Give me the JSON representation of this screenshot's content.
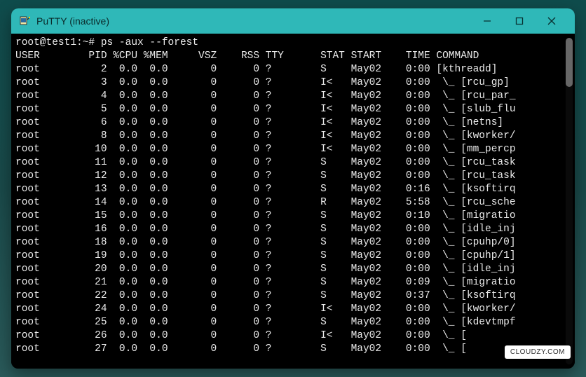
{
  "window": {
    "title": "PuTTY (inactive)"
  },
  "prompt": {
    "user_host": "root@test1",
    "path": "~",
    "symbol": "#",
    "command": "ps -aux --forest"
  },
  "headers": [
    "USER",
    "PID",
    "%CPU",
    "%MEM",
    "VSZ",
    "RSS",
    "TTY",
    "STAT",
    "START",
    "TIME",
    "COMMAND"
  ],
  "rows": [
    {
      "user": "root",
      "pid": "2",
      "cpu": "0.0",
      "mem": "0.0",
      "vsz": "0",
      "rss": "0",
      "tty": "?",
      "stat": "S",
      "start": "May02",
      "time": "0:00",
      "cmd": "[kthreadd]"
    },
    {
      "user": "root",
      "pid": "3",
      "cpu": "0.0",
      "mem": "0.0",
      "vsz": "0",
      "rss": "0",
      "tty": "?",
      "stat": "I<",
      "start": "May02",
      "time": "0:00",
      "cmd": " \\_ [rcu_gp]"
    },
    {
      "user": "root",
      "pid": "4",
      "cpu": "0.0",
      "mem": "0.0",
      "vsz": "0",
      "rss": "0",
      "tty": "?",
      "stat": "I<",
      "start": "May02",
      "time": "0:00",
      "cmd": " \\_ [rcu_par_"
    },
    {
      "user": "root",
      "pid": "5",
      "cpu": "0.0",
      "mem": "0.0",
      "vsz": "0",
      "rss": "0",
      "tty": "?",
      "stat": "I<",
      "start": "May02",
      "time": "0:00",
      "cmd": " \\_ [slub_flu"
    },
    {
      "user": "root",
      "pid": "6",
      "cpu": "0.0",
      "mem": "0.0",
      "vsz": "0",
      "rss": "0",
      "tty": "?",
      "stat": "I<",
      "start": "May02",
      "time": "0:00",
      "cmd": " \\_ [netns]"
    },
    {
      "user": "root",
      "pid": "8",
      "cpu": "0.0",
      "mem": "0.0",
      "vsz": "0",
      "rss": "0",
      "tty": "?",
      "stat": "I<",
      "start": "May02",
      "time": "0:00",
      "cmd": " \\_ [kworker/"
    },
    {
      "user": "root",
      "pid": "10",
      "cpu": "0.0",
      "mem": "0.0",
      "vsz": "0",
      "rss": "0",
      "tty": "?",
      "stat": "I<",
      "start": "May02",
      "time": "0:00",
      "cmd": " \\_ [mm_percp"
    },
    {
      "user": "root",
      "pid": "11",
      "cpu": "0.0",
      "mem": "0.0",
      "vsz": "0",
      "rss": "0",
      "tty": "?",
      "stat": "S",
      "start": "May02",
      "time": "0:00",
      "cmd": " \\_ [rcu_task"
    },
    {
      "user": "root",
      "pid": "12",
      "cpu": "0.0",
      "mem": "0.0",
      "vsz": "0",
      "rss": "0",
      "tty": "?",
      "stat": "S",
      "start": "May02",
      "time": "0:00",
      "cmd": " \\_ [rcu_task"
    },
    {
      "user": "root",
      "pid": "13",
      "cpu": "0.0",
      "mem": "0.0",
      "vsz": "0",
      "rss": "0",
      "tty": "?",
      "stat": "S",
      "start": "May02",
      "time": "0:16",
      "cmd": " \\_ [ksoftirq"
    },
    {
      "user": "root",
      "pid": "14",
      "cpu": "0.0",
      "mem": "0.0",
      "vsz": "0",
      "rss": "0",
      "tty": "?",
      "stat": "R",
      "start": "May02",
      "time": "5:58",
      "cmd": " \\_ [rcu_sche"
    },
    {
      "user": "root",
      "pid": "15",
      "cpu": "0.0",
      "mem": "0.0",
      "vsz": "0",
      "rss": "0",
      "tty": "?",
      "stat": "S",
      "start": "May02",
      "time": "0:10",
      "cmd": " \\_ [migratio"
    },
    {
      "user": "root",
      "pid": "16",
      "cpu": "0.0",
      "mem": "0.0",
      "vsz": "0",
      "rss": "0",
      "tty": "?",
      "stat": "S",
      "start": "May02",
      "time": "0:00",
      "cmd": " \\_ [idle_inj"
    },
    {
      "user": "root",
      "pid": "18",
      "cpu": "0.0",
      "mem": "0.0",
      "vsz": "0",
      "rss": "0",
      "tty": "?",
      "stat": "S",
      "start": "May02",
      "time": "0:00",
      "cmd": " \\_ [cpuhp/0]"
    },
    {
      "user": "root",
      "pid": "19",
      "cpu": "0.0",
      "mem": "0.0",
      "vsz": "0",
      "rss": "0",
      "tty": "?",
      "stat": "S",
      "start": "May02",
      "time": "0:00",
      "cmd": " \\_ [cpuhp/1]"
    },
    {
      "user": "root",
      "pid": "20",
      "cpu": "0.0",
      "mem": "0.0",
      "vsz": "0",
      "rss": "0",
      "tty": "?",
      "stat": "S",
      "start": "May02",
      "time": "0:00",
      "cmd": " \\_ [idle_inj"
    },
    {
      "user": "root",
      "pid": "21",
      "cpu": "0.0",
      "mem": "0.0",
      "vsz": "0",
      "rss": "0",
      "tty": "?",
      "stat": "S",
      "start": "May02",
      "time": "0:09",
      "cmd": " \\_ [migratio"
    },
    {
      "user": "root",
      "pid": "22",
      "cpu": "0.0",
      "mem": "0.0",
      "vsz": "0",
      "rss": "0",
      "tty": "?",
      "stat": "S",
      "start": "May02",
      "time": "0:37",
      "cmd": " \\_ [ksoftirq"
    },
    {
      "user": "root",
      "pid": "24",
      "cpu": "0.0",
      "mem": "0.0",
      "vsz": "0",
      "rss": "0",
      "tty": "?",
      "stat": "I<",
      "start": "May02",
      "time": "0:00",
      "cmd": " \\_ [kworker/"
    },
    {
      "user": "root",
      "pid": "25",
      "cpu": "0.0",
      "mem": "0.0",
      "vsz": "0",
      "rss": "0",
      "tty": "?",
      "stat": "S",
      "start": "May02",
      "time": "0:00",
      "cmd": " \\_ [kdevtmpf"
    },
    {
      "user": "root",
      "pid": "26",
      "cpu": "0.0",
      "mem": "0.0",
      "vsz": "0",
      "rss": "0",
      "tty": "?",
      "stat": "I<",
      "start": "May02",
      "time": "0:00",
      "cmd": " \\_ ["
    },
    {
      "user": "root",
      "pid": "27",
      "cpu": "0.0",
      "mem": "0.0",
      "vsz": "0",
      "rss": "0",
      "tty": "?",
      "stat": "S",
      "start": "May02",
      "time": "0:00",
      "cmd": " \\_ ["
    }
  ],
  "watermark": "CLOUDZY.COM"
}
